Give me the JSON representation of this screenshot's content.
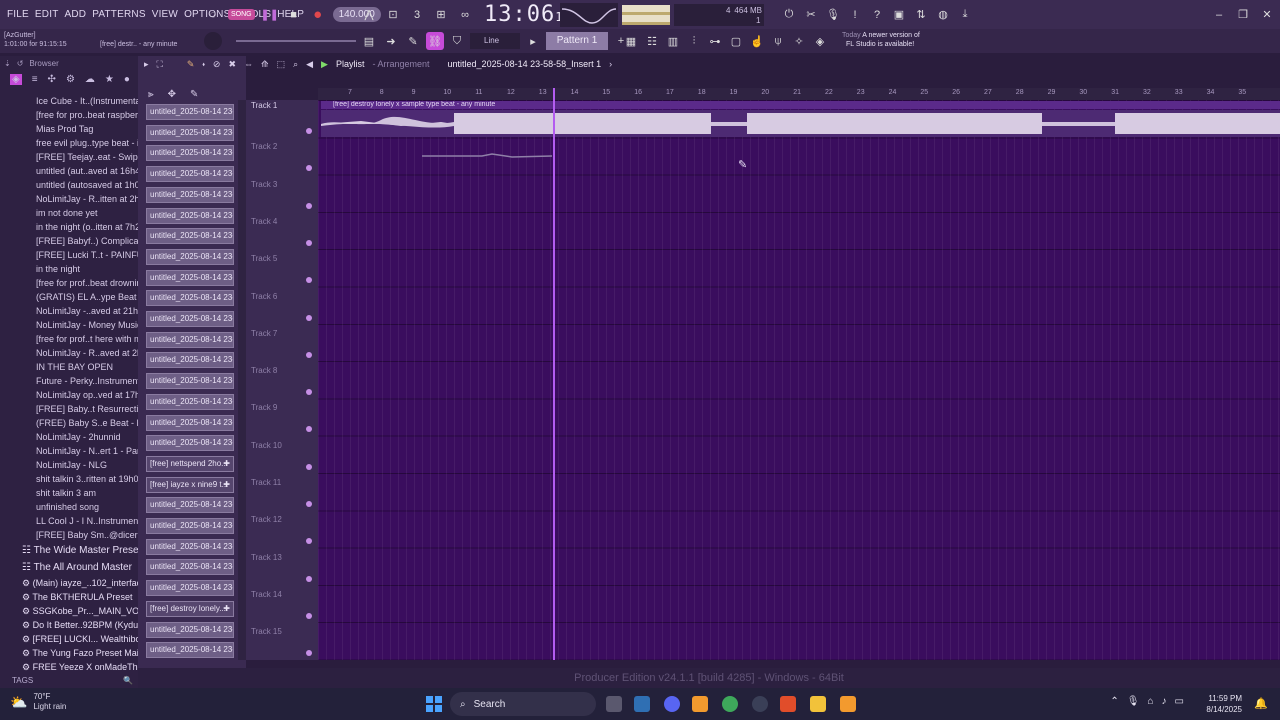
{
  "menu": [
    "FILE",
    "EDIT",
    "ADD",
    "PATTERNS",
    "VIEW",
    "OPTIONS",
    "TOOLS",
    "HELP"
  ],
  "transport": {
    "song_label": "SONG",
    "tempo": "140.000",
    "clock": "13:06",
    "clock_sub": "18"
  },
  "cpu": {
    "mem": "464 MB",
    "poly": "4",
    "cpu": "1"
  },
  "hint": {
    "user": "[AzGutter]",
    "position": "1:01:00 for 91:15:15",
    "sample": "[free] destr.. - any minute"
  },
  "snap": "Line",
  "pattern": "Pattern 1",
  "news": {
    "day": "Today",
    "line1": "A newer version of",
    "line2": "FL Studio is available!"
  },
  "browser": {
    "label": "Browser",
    "items": [
      "Ice Cube - It..(Instrumental)",
      "[free for pro..beat raspberry",
      "Mias Prod Tag",
      "free evil plug..type beat - isk",
      "[FREE] Teejay..eat - Swiping",
      "untitled (aut..aved at 16h41)",
      "untitled (autosaved at 1h07)",
      "NoLimitJay - R..itten at 2h37)",
      "im not done yet",
      "in the night (o..itten at 7h24)",
      "[FREE] Babyf..) Complicated",
      "[FREE] Lucki T..t - PAINFULL",
      "in the night",
      "[free for prof..beat drowning",
      "(GRATIS) EL A..ype Beat 2024",
      "NoLimitJay -..aved at 21h59)",
      "NoLimitJay - Money Music",
      "[free for prof..t here with me",
      "NoLimitJay - R..aved at 2h22)",
      "IN THE BAY OPEN",
      "Future - Perky..Instrumental)",
      "NoLimitJay op..ved at 17h39)",
      "[FREE] Baby..t Resurrection",
      "(FREE) Baby S..e Beat - PTSD",
      "NoLimitJay - 2hunnid",
      "NoLimitJay - N..ert 1 - Part_1",
      "NoLimitJay - NLG",
      "shit talkin 3..ritten at 19h02)",
      "shit talkin 3 am",
      "unfinished song",
      "LL Cool J - I N..Instrumental)",
      "[FREE] Baby Sm..@dicerollaa"
    ],
    "presets": [
      "The Wide Master Preset",
      "The All Around Master",
      "(Main) iayze_..102_interface",
      "The BKTHERULA Preset",
      "SSGKobe_Pr..._MAIN_VOCAL",
      "Do It Better..92BPM (Kyduh)",
      "[FREE] LUCKI... Wealthiboi.)",
      "The Yung Fazo Preset Main",
      "FREE Yeeze X onMadeThis"
    ],
    "tags": "TAGS"
  },
  "channels": [
    "untitled_2025-08-14 23-...",
    "untitled_2025-08-14 23-...",
    "untitled_2025-08-14 23-...",
    "untitled_2025-08-14 23-...",
    "untitled_2025-08-14 23-...",
    "untitled_2025-08-14 23-...",
    "untitled_2025-08-14 23-...",
    "untitled_2025-08-14 23-...",
    "untitled_2025-08-14 23-...",
    "untitled_2025-08-14 23-...",
    "untitled_2025-08-14 23-...",
    "untitled_2025-08-14 23-...",
    "untitled_2025-08-14 23-...",
    "untitled_2025-08-14 23-...",
    "untitled_2025-08-14 23-...",
    "untitled_2025-08-14 23-...",
    "untitled_2025-08-14 23-...",
    "[free] nettspend 2ho...",
    "[free] iayze x nine9 t...",
    "untitled_2025-08-14 23-...",
    "untitled_2025-08-14 23-...",
    "untitled_2025-08-14 23-...",
    "untitled_2025-08-14 23-...",
    "untitled_2025-08-14 23-...",
    "[free] destroy lonely...",
    "untitled_2025-08-14 23-...",
    "untitled_2025-08-14 23-..."
  ],
  "playlist": {
    "title": "Playlist",
    "subtitle": "Arrangement",
    "file": "untitled_2025-08-14 23-58-58_Insert 1",
    "clip": "[free] destroy lonely x sample type beat - any minute",
    "tracks": [
      "Track 1",
      "Track 2",
      "Track 3",
      "Track 4",
      "Track 5",
      "Track 6",
      "Track 7",
      "Track 8",
      "Track 9",
      "Track 10",
      "Track 11",
      "Track 12",
      "Track 13",
      "Track 14",
      "Track 15"
    ],
    "ruler": [
      "7",
      "8",
      "9",
      "10",
      "11",
      "12",
      "13",
      "14",
      "15",
      "16",
      "17",
      "18",
      "19",
      "20",
      "21",
      "22",
      "23",
      "24",
      "25",
      "26",
      "27",
      "28",
      "29",
      "30",
      "31",
      "32",
      "33",
      "34",
      "35"
    ]
  },
  "status": "Producer Edition v24.1.1 [build 4285] - Windows - 64Bit",
  "taskbar": {
    "temp": "70°F",
    "weather": "Light rain",
    "search": "Search",
    "time": "11:59 PM",
    "date": "8/14/2025"
  },
  "colors": {
    "accent": "#b35cf0",
    "record": "#e0474c",
    "grid": "#3a0d5e"
  }
}
